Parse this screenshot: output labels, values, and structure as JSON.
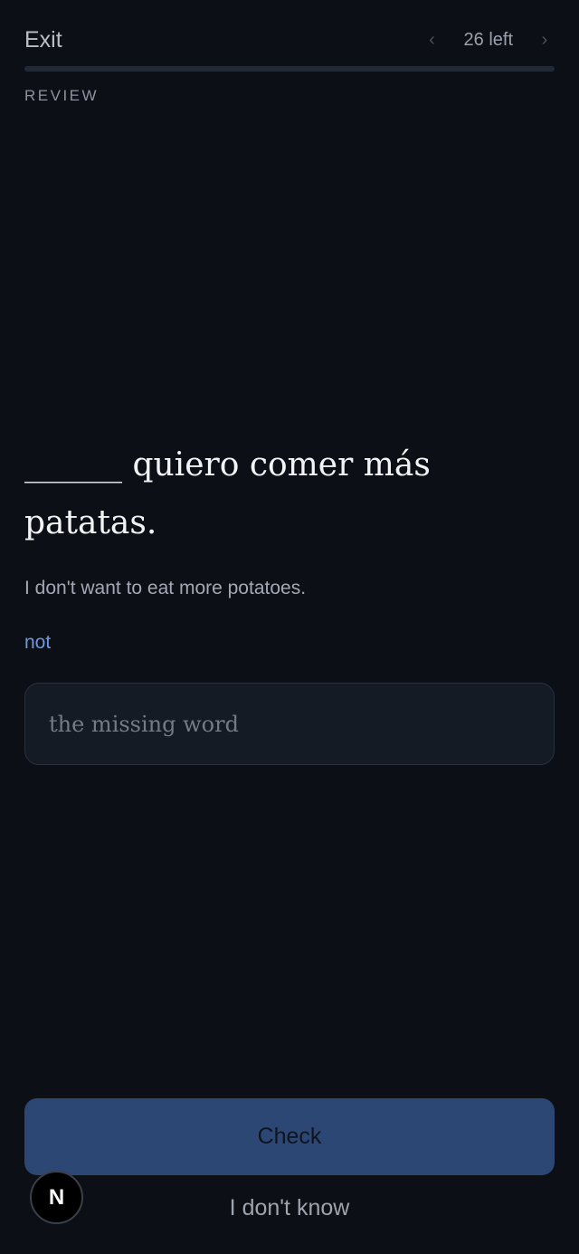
{
  "header": {
    "exit_label": "Exit",
    "prev_icon": "chevron-left-icon",
    "remaining_text": "26 left",
    "next_icon": "chevron-right-icon",
    "progress_fraction": 0,
    "mode_label": "REVIEW"
  },
  "card": {
    "prompt": "______ quiero comer más patatas.",
    "translation": "I don't want to eat more potatoes.",
    "hint": "not"
  },
  "answer": {
    "value": "",
    "placeholder": "the missing word"
  },
  "actions": {
    "check_label": "Check",
    "dont_know_label": "I don't know"
  },
  "badge": {
    "letter": "N"
  },
  "colors": {
    "background": "#0c0f15",
    "accent": "#2d4775",
    "hint": "#6d98de"
  }
}
